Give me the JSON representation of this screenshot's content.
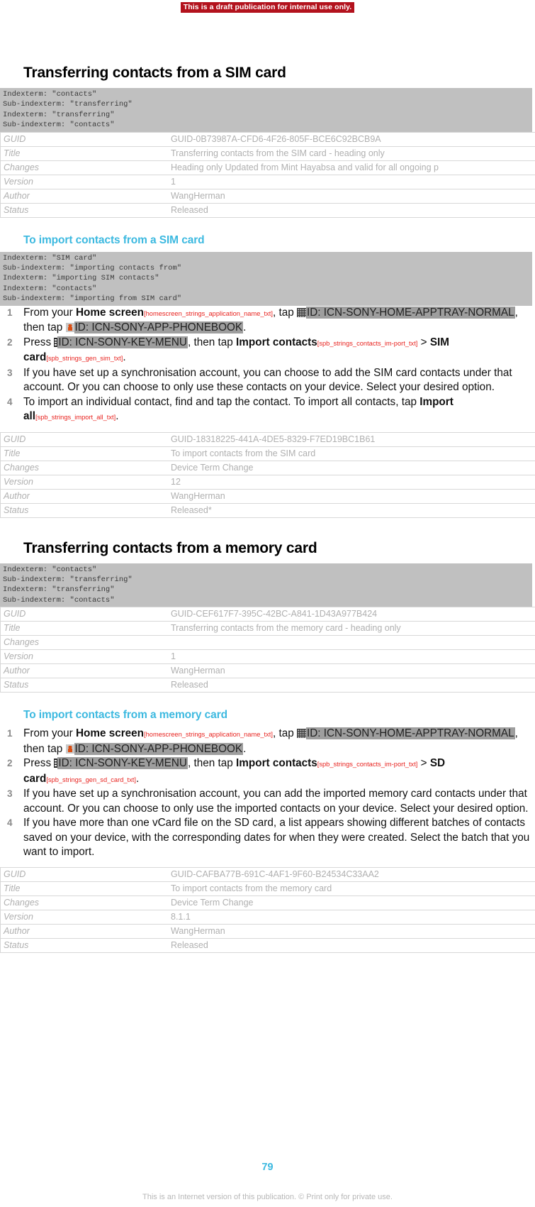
{
  "banner": {
    "text": "This is a draft publication for internal use only."
  },
  "colors": {
    "banner_bg": "#b3121d",
    "accent": "#3cb9e0",
    "string_id": "#e8231f",
    "highlight": "#9e9e9e",
    "index_block_bg": "#c0c0c0",
    "meta_text": "#b0b0b0"
  },
  "meta_labels": {
    "guid": "GUID",
    "title": "Title",
    "changes": "Changes",
    "version": "Version",
    "author": "Author",
    "status": "Status"
  },
  "sections": [
    {
      "heading": "Transferring contacts from a SIM card",
      "indexterms": "Indexterm: \"contacts\"\nSub-indexterm: \"transferring\"\nIndexterm: \"transferring\"\nSub-indexterm: \"contacts\"",
      "meta": {
        "guid": "GUID-0B73987A-CFD6-4F26-805F-BCE6C92BCB9A",
        "title": "Transferring contacts from the SIM card - heading only",
        "changes": "Heading only Updated from Mint Hayabsa and valid for all ongoing p",
        "version": "1",
        "author": "WangHerman",
        "status": "Released"
      }
    },
    {
      "heading": "To import contacts from a SIM card",
      "indexterms": "Indexterm: \"SIM card\"\nSub-indexterm: \"importing contacts from\"\nIndexterm: \"importing SIM contacts\"\nIndexterm: \"contacts\"\nSub-indexterm: \"importing from SIM card\"",
      "steps": {
        "s1": {
          "num": "1",
          "t1": "From your ",
          "bold1": "Home screen",
          "id1": "[homescreen_strings_application_name_txt]",
          "t2": ", tap ",
          "hl1": "ID: ICN-SONY-HOME-APPTRAY-NORMAL",
          "t3": ", then tap ",
          "hl2": "ID: ICN-SONY-APP-PHONEBOOK",
          "t4": "."
        },
        "s2": {
          "num": "2",
          "t1": "Press ",
          "hl1": "ID: ICN-SONY-KEY-MENU",
          "t2": ", then tap ",
          "bold1": "Import contacts",
          "id1": "[spb_strings_contacts_im-port_txt]",
          "t3": " > ",
          "bold2": "SIM card",
          "id2": "[spb_strings_gen_sim_txt]",
          "t4": "."
        },
        "s3": {
          "num": "3",
          "text": "If you have set up a synchronisation account, you can choose to add the SIM card contacts under that account. Or you can choose to only use these contacts on your device. Select your desired option."
        },
        "s4": {
          "num": "4",
          "t1": "To import an individual contact, find and tap the contact. To import all contacts, tap ",
          "bold1": "Import all",
          "id1": "[spb_strings_import_all_txt]",
          "t2": "."
        }
      },
      "meta": {
        "guid": "GUID-18318225-441A-4DE5-8329-F7ED19BC1B61",
        "title": "To import contacts from the SIM card",
        "changes": "Device Term Change",
        "version": "12",
        "author": "WangHerman",
        "status": "Released*"
      }
    },
    {
      "heading": "Transferring contacts from a memory card",
      "indexterms": "Indexterm: \"contacts\"\nSub-indexterm: \"transferring\"\nIndexterm: \"transferring\"\nSub-indexterm: \"contacts\"",
      "meta": {
        "guid": "GUID-CEF617F7-395C-42BC-A841-1D43A977B424",
        "title": "Transferring contacts from the memory card - heading only",
        "changes": "",
        "version": "1",
        "author": "WangHerman",
        "status": "Released"
      }
    },
    {
      "heading": "To import contacts from a memory card",
      "steps": {
        "s1": {
          "num": "1",
          "t1": "From your ",
          "bold1": "Home screen",
          "id1": "[homescreen_strings_application_name_txt]",
          "t2": ", tap ",
          "hl1": "ID: ICN-SONY-HOME-APPTRAY-NORMAL",
          "t3": ", then tap ",
          "hl2": "ID: ICN-SONY-APP-PHONEBOOK",
          "t4": "."
        },
        "s2": {
          "num": "2",
          "t1": "Press ",
          "hl1": "ID: ICN-SONY-KEY-MENU",
          "t2": ", then tap ",
          "bold1": "Import contacts",
          "id1": "[spb_strings_contacts_im-port_txt]",
          "t3": " > ",
          "bold2": "SD card",
          "id2": "[spb_strings_gen_sd_card_txt]",
          "t4": "."
        },
        "s3": {
          "num": "3",
          "text": "If you have set up a synchronisation account, you can add the imported memory card contacts under that account. Or you can choose to only use the imported contacts on your device. Select your desired option."
        },
        "s4": {
          "num": "4",
          "text": "If you have more than one vCard file on the SD card, a list appears showing different batches of contacts saved on your device, with the corresponding dates for when they were created. Select the batch that you want to import."
        }
      },
      "meta": {
        "guid": "GUID-CAFBA77B-691C-4AF1-9F60-B24534C33AA2",
        "title": "To import contacts from the memory card",
        "changes": "Device Term Change",
        "version": "8.1.1",
        "author": "WangHerman",
        "status": "Released"
      }
    }
  ],
  "footer": {
    "page_number": "79",
    "notice": "This is an Internet version of this publication. © Print only for private use."
  }
}
